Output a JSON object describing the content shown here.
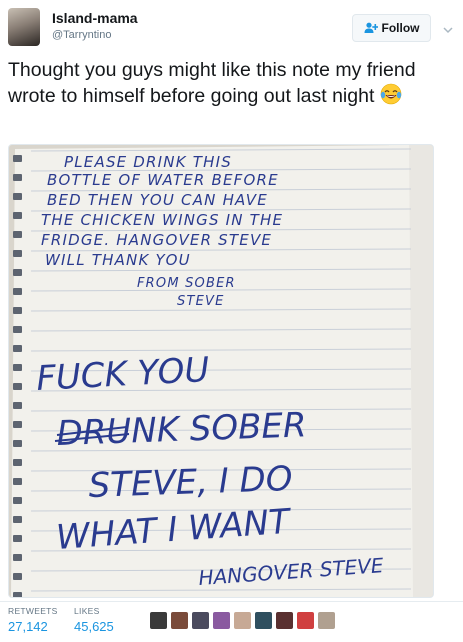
{
  "user": {
    "display_name": "Island-mama",
    "handle": "@Tarryntino"
  },
  "follow_button": {
    "label": "Follow"
  },
  "tweet": {
    "text": "Thought you guys might like this note my friend wrote to himself before going out last night",
    "emoji": "face-with-tears-of-joy"
  },
  "image": {
    "handwritten_note": {
      "lines": [
        "PLEASE DRINK THIS",
        "BOTTLE OF WATER BEFORE",
        "BED THEN YOU CAN HAVE",
        "THE CHICKEN WINGS IN THE",
        "FRIDGE. HANGOVER STEVE",
        "WILL THANK YOU",
        "FROM SOBER",
        "STEVE"
      ],
      "reply_lines": [
        "FUCK YOU",
        "DRUNK SOBER",
        "STEVE, I DO",
        "WHAT I WANT",
        "HANGOVER STEVE"
      ]
    }
  },
  "stats": {
    "retweets_label": "RETWEETS",
    "retweets_value": "27,142",
    "likes_label": "LIKES",
    "likes_value": "45,625"
  },
  "likers": [
    "liker-avatar-1",
    "liker-avatar-2",
    "liker-avatar-3",
    "liker-avatar-4",
    "liker-avatar-5",
    "liker-avatar-6",
    "liker-avatar-7",
    "liker-avatar-8",
    "liker-avatar-9"
  ],
  "colors": {
    "link_blue": "#1b95e0",
    "secondary_text": "#657786",
    "ink_blue": "#2a3b8f",
    "paper": "#f2f1ec"
  }
}
